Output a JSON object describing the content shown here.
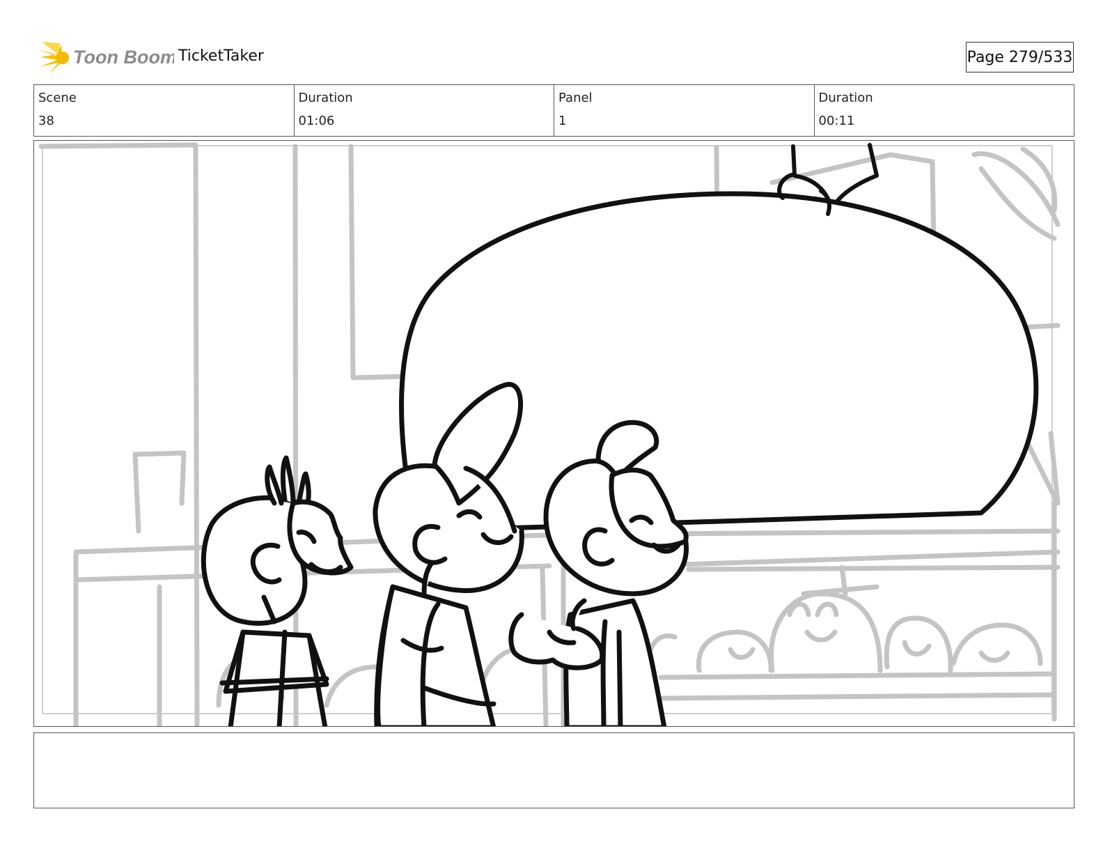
{
  "header": {
    "logo_text": "Toon Boom",
    "project_title": "TicketTaker",
    "page_label": "Page 279/533"
  },
  "info": {
    "scene_label": "Scene",
    "scene_value": "38",
    "scene_duration_label": "Duration",
    "scene_duration_value": "01:06",
    "panel_label": "Panel",
    "panel_value": "1",
    "panel_duration_label": "Duration",
    "panel_duration_value": "00:11"
  },
  "colors": {
    "logo_accent": "#f5c400",
    "logo_text": "#8a8a8a",
    "sketch_ink": "#111111",
    "sketch_background": "#c4c4c4"
  }
}
